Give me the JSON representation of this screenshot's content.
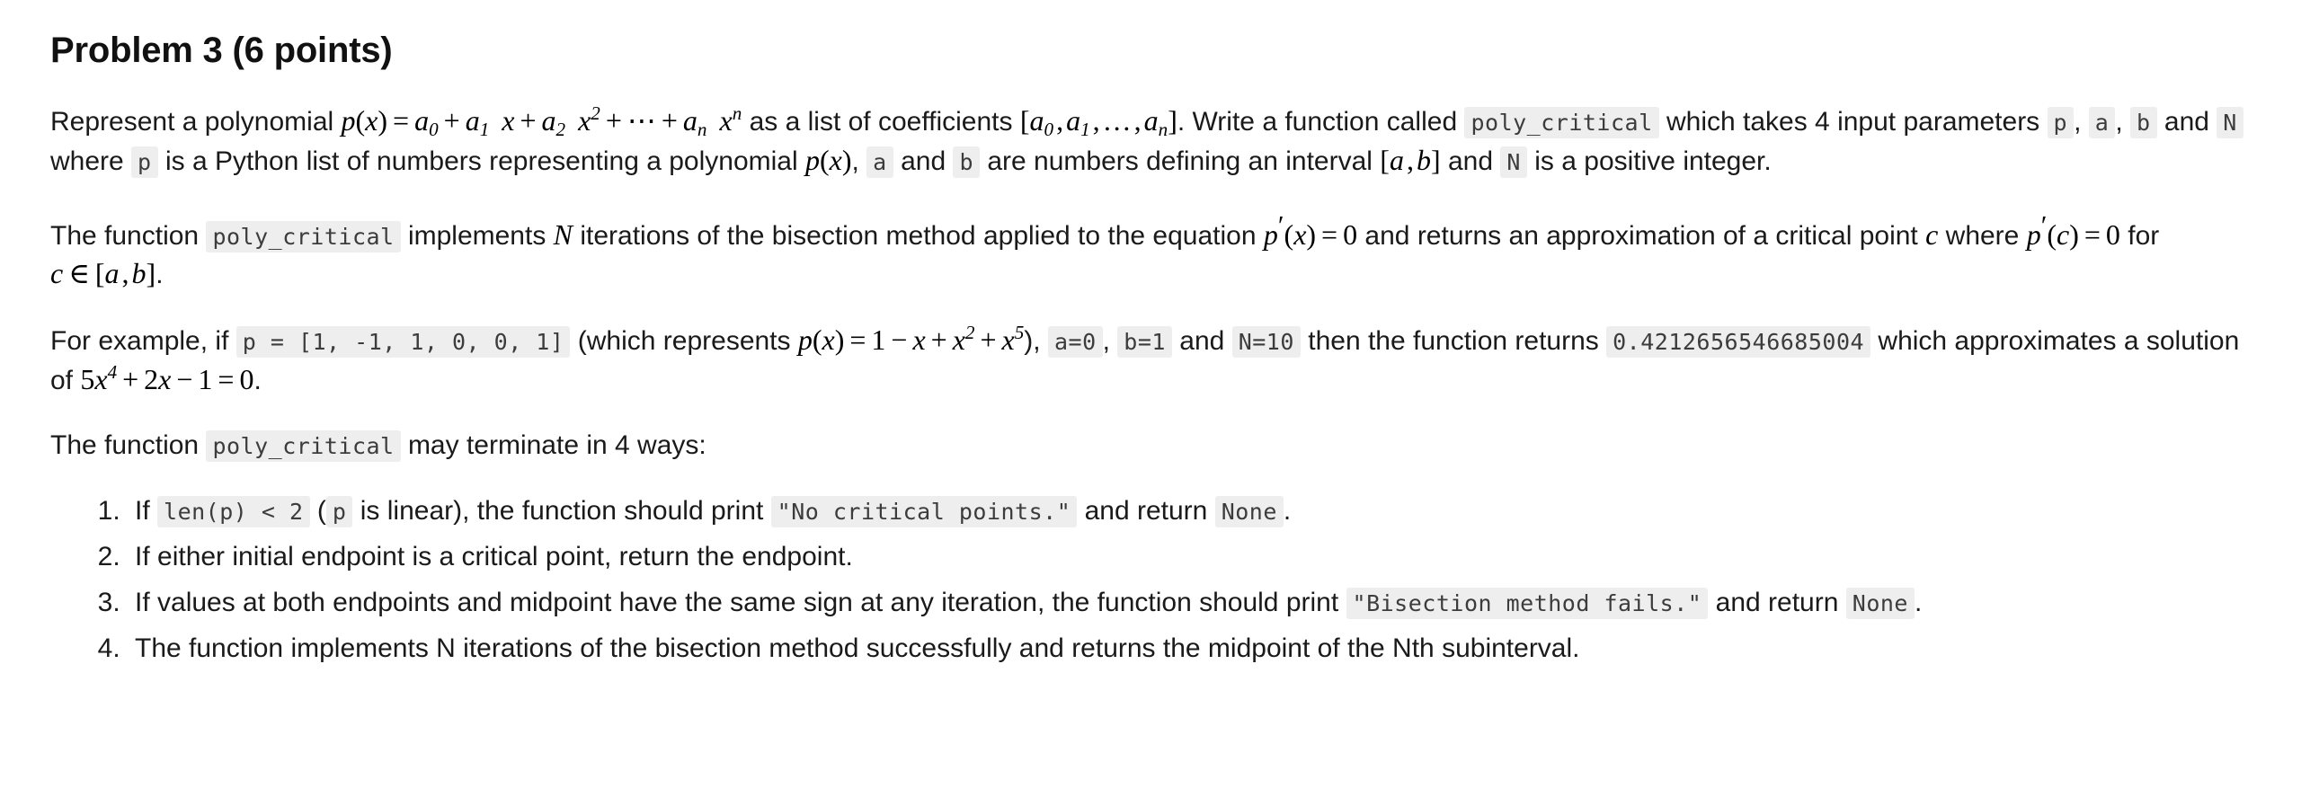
{
  "document": {
    "title": "Problem 3 (6 points)",
    "paragraphs": {
      "p1": {
        "t1": "Represent a polynomial ",
        "math1_parts": {
          "p": "p",
          "lpar": "(",
          "x": "x",
          "rpar": ")",
          "eq": "=",
          "a": "a",
          "sub0": "0",
          "plus": "+",
          "a1sub": "1",
          "xvar": "x",
          "a2sub": "2",
          "x2sup": "2",
          "dots": "⋯",
          "ansub": "n",
          "xnsup": "n"
        },
        "t2": " as a list of coefficients ",
        "math2_parts": {
          "lb": "[",
          "a": "a",
          "sub0": "0",
          "comma": ",",
          "sub1": "1",
          "ldots": "…",
          "subn": "n",
          "rb": "]"
        },
        "t3": ". Write a function called ",
        "code_poly_critical": "poly_critical",
        "t4": " which takes 4 input parameters ",
        "code_p": "p",
        "comma1": ", ",
        "code_a": "a",
        "comma2": ", ",
        "code_b": "b",
        "t5": " and ",
        "code_N": "N",
        "t6": " where ",
        "code_p2": "p",
        "t7": " is a Python list of numbers representing a polynomial ",
        "t8": ", ",
        "code_a2": "a",
        "t9": " and ",
        "code_b2": "b",
        "t10": " are numbers defining an interval ",
        "t11": " and ",
        "code_N2": "N",
        "t12": " is a positive integer."
      },
      "p2": {
        "t1": "The function ",
        "code_poly_critical": "poly_critical",
        "t2": " implements ",
        "mathN": "N",
        "t3": " iterations of the bisection method applied to the equation ",
        "t4": " and returns an approximation of a critical point ",
        "mathc": "c",
        "t5": " where ",
        "t6": " for ",
        "t7": "."
      },
      "p3": {
        "t1": "For example, if ",
        "code_p_list": "p = [1, -1, 1, 0, 0, 1]",
        "t2": " (which represents ",
        "t3": "), ",
        "code_a0": "a=0",
        "comma": ", ",
        "code_b1": "b=1",
        "t4": " and ",
        "code_N10": "N=10",
        "t5": " then the function returns ",
        "code_result": "0.4212656546685004",
        "t6": " which approximates a solution of ",
        "t7": "."
      },
      "p4": {
        "t1": "The function ",
        "code_poly_critical": "poly_critical",
        "t2": " may terminate in 4 ways:"
      }
    },
    "termination_list": {
      "item1": {
        "t1": "If ",
        "code_len": "len(p) < 2",
        "t2": " (",
        "code_p": "p",
        "t3": " is linear), the function should print ",
        "code_msg": "\"No critical points.\"",
        "t4": " and return ",
        "code_none": "None",
        "t5": "."
      },
      "item2": {
        "t1": "If either initial endpoint is a critical point, return the endpoint."
      },
      "item3": {
        "t1": "If values at both endpoints and midpoint have the same sign at any iteration, the function should print ",
        "code_msg": "\"Bisection method fails.\"",
        "t2": " and return ",
        "code_none": "None",
        "t3": "."
      },
      "item4": {
        "t1": "The function implements N iterations of the bisection method successfully and returns the midpoint of the Nth subinterval."
      }
    },
    "colors": {
      "code_bg": "#eeeeee",
      "code_fg": "#3c3c3c",
      "text": "#1a1a1a",
      "background": "#ffffff"
    }
  }
}
